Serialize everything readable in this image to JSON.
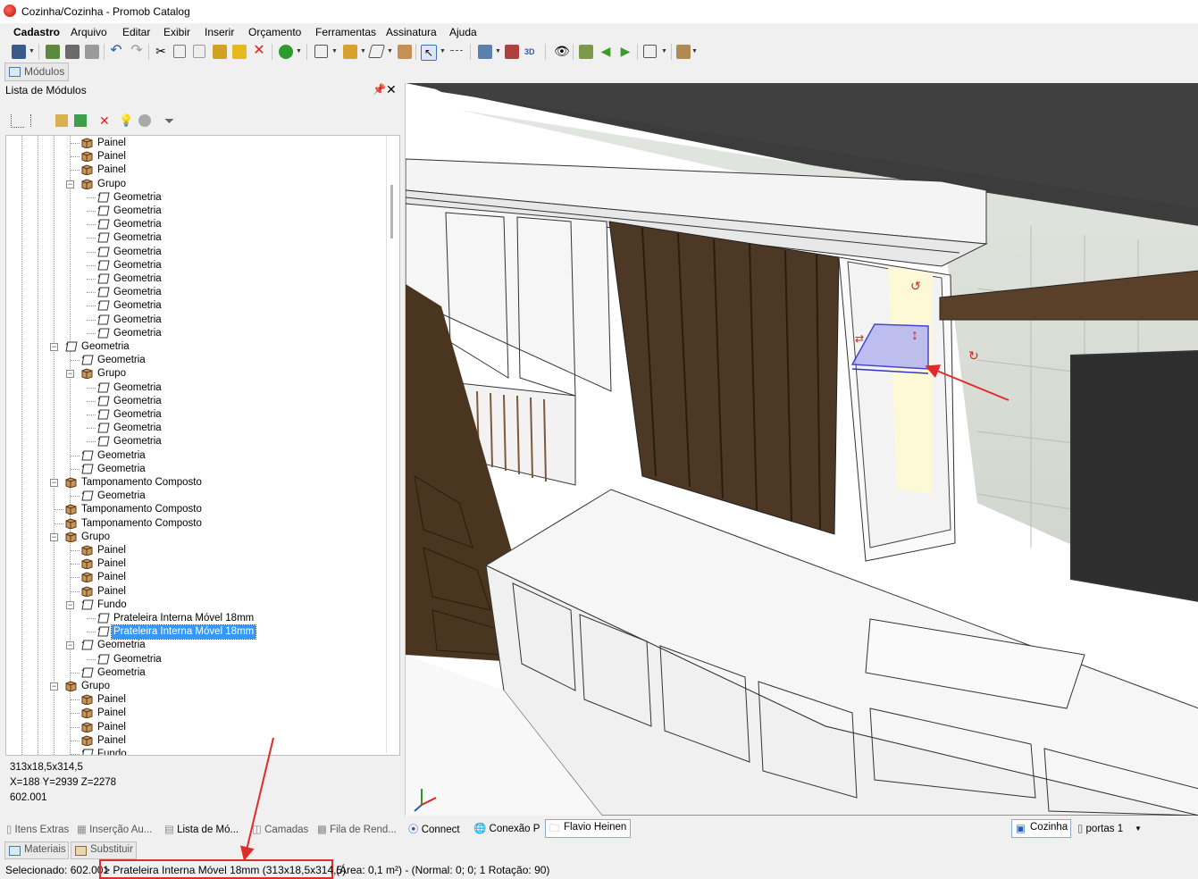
{
  "window": {
    "title": "Cozinha/Cozinha - Promob Catalog"
  },
  "menu": [
    "Cadastro",
    "Arquivo",
    "Editar",
    "Exibir",
    "Inserir",
    "Orçamento",
    "Ferramentas",
    "Assinatura",
    "Ajuda"
  ],
  "modules_tab": "Módulos",
  "panel": {
    "title": "Lista de Módulos"
  },
  "tree": [
    {
      "label": "Painel",
      "level": 4,
      "icon": "box"
    },
    {
      "label": "Painel",
      "level": 4,
      "icon": "box"
    },
    {
      "label": "Painel",
      "level": 4,
      "icon": "box"
    },
    {
      "label": "Grupo",
      "level": 4,
      "icon": "box",
      "expanded": true
    },
    {
      "label": "Geometria",
      "level": 5,
      "icon": "geo"
    },
    {
      "label": "Geometria",
      "level": 5,
      "icon": "geo"
    },
    {
      "label": "Geometria",
      "level": 5,
      "icon": "geo"
    },
    {
      "label": "Geometria",
      "level": 5,
      "icon": "geo"
    },
    {
      "label": "Geometria",
      "level": 5,
      "icon": "geo"
    },
    {
      "label": "Geometria",
      "level": 5,
      "icon": "geo"
    },
    {
      "label": "Geometria",
      "level": 5,
      "icon": "geo"
    },
    {
      "label": "Geometria",
      "level": 5,
      "icon": "geo"
    },
    {
      "label": "Geometria",
      "level": 5,
      "icon": "geo"
    },
    {
      "label": "Geometria",
      "level": 5,
      "icon": "geo"
    },
    {
      "label": "Geometria",
      "level": 5,
      "icon": "geo"
    },
    {
      "label": "Geometria",
      "level": 3,
      "icon": "geo",
      "expanded": true
    },
    {
      "label": "Geometria",
      "level": 4,
      "icon": "geo"
    },
    {
      "label": "Grupo",
      "level": 4,
      "icon": "box",
      "expanded": true
    },
    {
      "label": "Geometria",
      "level": 5,
      "icon": "geo"
    },
    {
      "label": "Geometria",
      "level": 5,
      "icon": "geo"
    },
    {
      "label": "Geometria",
      "level": 5,
      "icon": "geo"
    },
    {
      "label": "Geometria",
      "level": 5,
      "icon": "geo"
    },
    {
      "label": "Geometria",
      "level": 5,
      "icon": "geo"
    },
    {
      "label": "Geometria",
      "level": 4,
      "icon": "geo"
    },
    {
      "label": "Geometria",
      "level": 4,
      "icon": "geo"
    },
    {
      "label": "Tamponamento Composto",
      "level": 3,
      "icon": "box",
      "expanded": true
    },
    {
      "label": "Geometria",
      "level": 4,
      "icon": "geo"
    },
    {
      "label": "Tamponamento Composto",
      "level": 3,
      "icon": "box"
    },
    {
      "label": "Tamponamento Composto",
      "level": 3,
      "icon": "box"
    },
    {
      "label": "Grupo",
      "level": 3,
      "icon": "box",
      "expanded": true
    },
    {
      "label": "Painel",
      "level": 4,
      "icon": "box"
    },
    {
      "label": "Painel",
      "level": 4,
      "icon": "box"
    },
    {
      "label": "Painel",
      "level": 4,
      "icon": "box"
    },
    {
      "label": "Painel",
      "level": 4,
      "icon": "box"
    },
    {
      "label": "Fundo",
      "level": 4,
      "icon": "geo",
      "expanded": true
    },
    {
      "label": "Prateleira Interna Móvel 18mm",
      "level": 5,
      "icon": "geo"
    },
    {
      "label": "Prateleira Interna Móvel 18mm",
      "level": 5,
      "icon": "geo",
      "selected": true
    },
    {
      "label": "Geometria",
      "level": 4,
      "icon": "geo",
      "expanded": true
    },
    {
      "label": "Geometria",
      "level": 5,
      "icon": "geo"
    },
    {
      "label": "Geometria",
      "level": 4,
      "icon": "geo"
    },
    {
      "label": "Grupo",
      "level": 3,
      "icon": "box",
      "expanded": true
    },
    {
      "label": "Painel",
      "level": 4,
      "icon": "box"
    },
    {
      "label": "Painel",
      "level": 4,
      "icon": "box"
    },
    {
      "label": "Painel",
      "level": 4,
      "icon": "box"
    },
    {
      "label": "Painel",
      "level": 4,
      "icon": "box"
    },
    {
      "label": "Fundo",
      "level": 4,
      "icon": "geo"
    }
  ],
  "info": {
    "dimensions": "313x18,5x314,5",
    "position": "X=188  Y=2939  Z=2278",
    "code": "602.001"
  },
  "bottom_tabs": [
    "Itens Extras",
    "Inserção Au...",
    "Lista de Mó...",
    "Camadas",
    "Fila de Rend..."
  ],
  "bottom_tabs2": [
    "Materiais",
    "Substituir"
  ],
  "status": {
    "selected": "Selecionado: 602.001",
    "item": "> Prateleira Interna Móvel 18mm (313x18,5x314,5)",
    "details": "(Área: 0,1 m²) - (Normal: 0; 0; 1 Rotação: 90)"
  },
  "viewport_tabs": {
    "left": [
      "Connect",
      "Conexão P",
      "Flavio Heinen"
    ],
    "right": [
      "Cozinha",
      "portas 1"
    ]
  },
  "colors": {
    "selection": "#3399ff",
    "highlight": "#e02b2b",
    "wood": "#4a3520"
  }
}
